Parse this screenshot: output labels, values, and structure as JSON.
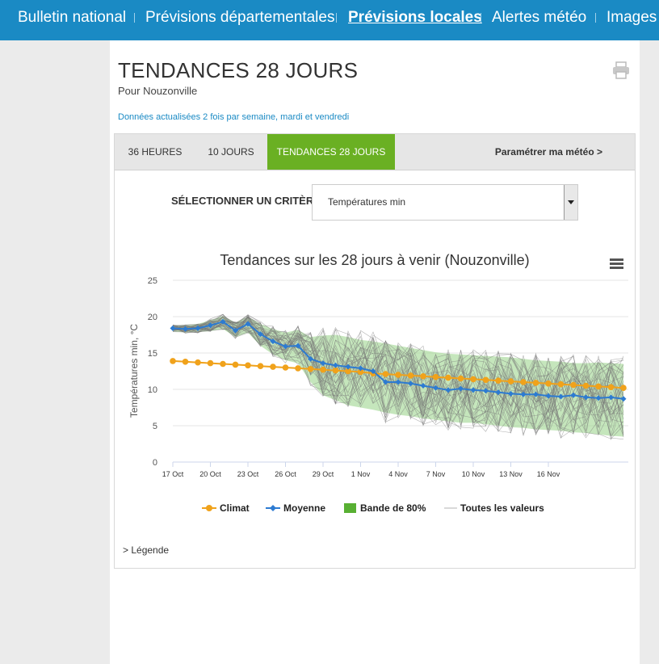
{
  "nav": {
    "items": [
      "Bulletin national",
      "Prévisions départementales",
      "Prévisions locales",
      "Alertes météo",
      "Images r"
    ],
    "active_index": 2
  },
  "page": {
    "title": "TENDANCES 28 JOURS",
    "subtitle": "Pour Nouzonville",
    "updated": "Données actualisées 2 fois par semaine, mardi et vendredi"
  },
  "tabs": [
    "36 HEURES",
    "10 JOURS",
    "TENDANCES 28 JOURS"
  ],
  "active_tab": 2,
  "param_link": "Paramétrer ma météo >",
  "criterion": {
    "label": "SÉLECTIONNER UN CRITÈRE",
    "value": "Températures min"
  },
  "legend_link": "> Légende",
  "colors": {
    "nav": "#1a8ac4",
    "tab_active": "#6ab023",
    "climat": "#f0a21b",
    "moyenne": "#2d7bd1",
    "band": "#9fd58f",
    "all_values": "#777777"
  },
  "chart_data": {
    "type": "line",
    "title": "Tendances sur les 28 jours à venir (Nouzonville)",
    "ylabel": "Températures min, °C",
    "ylim": [
      0,
      25
    ],
    "yticks": [
      0,
      5,
      10,
      15,
      20,
      25
    ],
    "x_start": "17 Oct",
    "xtick_labels": [
      "17 Oct",
      "20 Oct",
      "23 Oct",
      "26 Oct",
      "29 Oct",
      "1 Nov",
      "4 Nov",
      "7 Nov",
      "10 Nov",
      "13 Nov",
      "16 Nov"
    ],
    "legend": [
      "Climat",
      "Moyenne",
      "Bande de 80%",
      "Toutes les valeurs"
    ],
    "legend_position": "bottom",
    "series": [
      {
        "name": "Climat",
        "values": [
          13.9,
          13.8,
          13.7,
          13.6,
          13.5,
          13.4,
          13.3,
          13.2,
          13.1,
          13.0,
          12.9,
          12.8,
          12.7,
          12.6,
          12.5,
          12.4,
          12.2,
          12.1,
          12.0,
          11.9,
          11.8,
          11.7,
          11.6,
          11.5,
          11.4,
          11.3,
          11.2,
          11.1,
          11.0,
          10.9,
          10.8,
          10.7,
          10.6,
          10.5,
          10.4,
          10.3,
          10.2
        ]
      },
      {
        "name": "Moyenne",
        "values": [
          18.4,
          18.3,
          18.4,
          18.8,
          19.3,
          18.1,
          19.0,
          17.6,
          16.6,
          15.9,
          16.0,
          14.2,
          13.6,
          13.3,
          13.1,
          12.9,
          12.5,
          11.0,
          11.0,
          10.8,
          10.5,
          10.2,
          9.9,
          10.1,
          9.9,
          9.8,
          9.6,
          9.4,
          9.3,
          9.3,
          9.1,
          9.0,
          9.2,
          8.9,
          8.8,
          8.9,
          8.7
        ]
      },
      {
        "name": "Bande de 80%",
        "low": [
          18.0,
          17.8,
          17.9,
          18.0,
          18.3,
          17.2,
          17.8,
          16.0,
          14.8,
          14.0,
          13.6,
          11.0,
          9.2,
          8.5,
          7.8,
          7.5,
          7.2,
          6.8,
          6.5,
          6.3,
          6.0,
          5.8,
          5.6,
          5.4,
          5.4,
          5.2,
          5.0,
          4.8,
          4.7,
          4.5,
          4.4,
          4.3,
          4.1,
          4.0,
          3.8,
          3.6,
          3.5
        ],
        "high": [
          18.8,
          18.8,
          19.0,
          19.5,
          20.1,
          19.2,
          20.0,
          19.0,
          18.3,
          17.8,
          18.2,
          17.2,
          17.4,
          17.5,
          17.2,
          16.8,
          16.6,
          16.3,
          16.0,
          15.7,
          15.4,
          15.1,
          14.9,
          14.8,
          14.7,
          14.6,
          14.5,
          14.4,
          14.2,
          14.0,
          13.9,
          13.8,
          13.6,
          13.6,
          13.7,
          13.6,
          13.5
        ]
      }
    ]
  }
}
